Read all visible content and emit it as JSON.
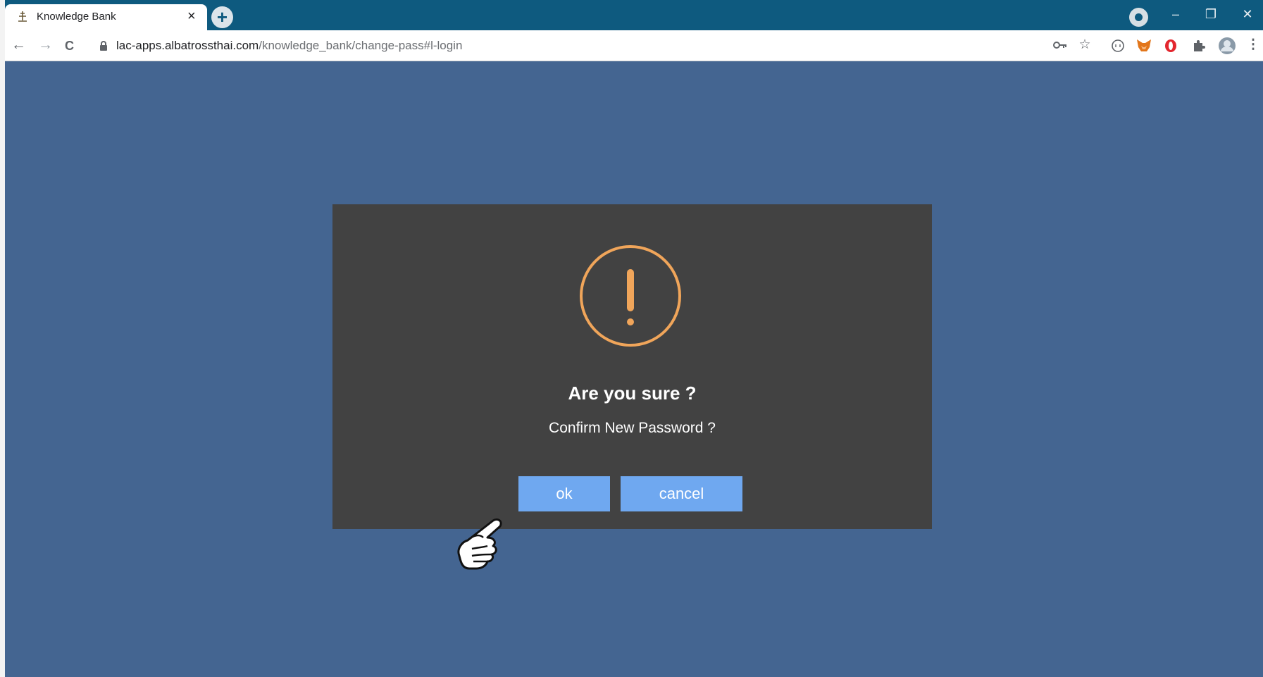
{
  "browser": {
    "tab": {
      "title": "Knowledge Bank",
      "close": "×"
    },
    "new_tab": "+",
    "window_controls": {
      "minimize": "–",
      "restore": "❐",
      "close": "✕"
    },
    "nav": {
      "back": "←",
      "forward": "→",
      "reload": "C"
    },
    "address": {
      "host": "lac-apps.albatrossthai.com",
      "path": "/knowledge_bank/change-pass#l-login"
    },
    "toolbar_icons": [
      "key-icon",
      "star-icon",
      "extension-icon",
      "metamask-fox-icon",
      "opera-icon",
      "puzzle-icon",
      "profile-avatar",
      "menu-icon"
    ]
  },
  "dialog": {
    "icon": "warning-exclamation-icon",
    "title": "Are you sure ?",
    "message": "Confirm New Password ?",
    "ok_label": "ok",
    "cancel_label": "cancel"
  },
  "colors": {
    "titlebar": "#0e5a7f",
    "page_background": "#446591",
    "dialog_background": "#424242",
    "warning_accent": "#f0a55a",
    "button": "#6fa8f0"
  }
}
